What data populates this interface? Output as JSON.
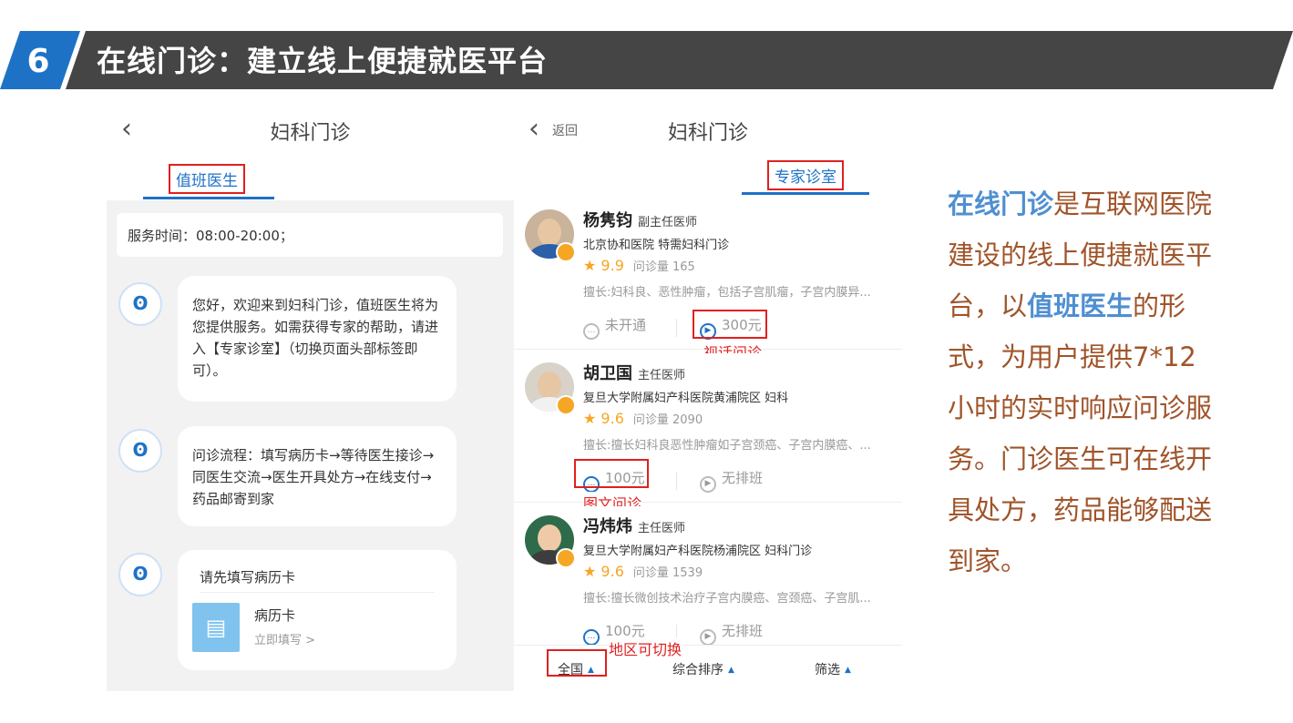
{
  "header": {
    "number": "6",
    "title": "在线门诊：建立线上便捷就医平台"
  },
  "left_screen": {
    "back_icon": "chevron-left-icon",
    "nav_title": "妇科门诊",
    "tab_label": "值班医生",
    "service_hours": "服务时间：08:00-20:00；",
    "messages": [
      "您好，欢迎来到妇科门诊，值班医生将为您提供服务。如需获得专家的帮助，请进入【专家诊室】（切换页面头部标签即可）。",
      "问诊流程：填写病历卡→等待医生接诊→同医生交流→医生开具处方→在线支付→药品邮寄到家"
    ],
    "form_prompt": "请先填写病历卡",
    "form_card": {
      "title": "病历卡",
      "link": "立即填写 >"
    }
  },
  "right_screen": {
    "back_label": "返回",
    "nav_title": "妇科门诊",
    "tab_label": "专家诊室",
    "doctors": [
      {
        "name": "杨隽钧",
        "title": "副主任医师",
        "hospital": "北京协和医院  特需妇科门诊",
        "rating": "★ 9.9",
        "volume": "问诊量 165",
        "specialty": "擅长:妇科良、恶性肿瘤，包括子宫肌瘤，子宫内膜异...",
        "service_a": "未开通",
        "service_b": "300元"
      },
      {
        "name": "胡卫国",
        "title": "主任医师",
        "hospital": "复旦大学附属妇产科医院黄浦院区  妇科",
        "rating": "★ 9.6",
        "volume": "问诊量 2090",
        "specialty": "擅长:擅长妇科良恶性肿瘤如子宫颈癌、子宫内膜癌、...",
        "service_a": "100元",
        "service_b": "无排班"
      },
      {
        "name": "冯炜炜",
        "title": "主任医师",
        "hospital": "复旦大学附属妇产科医院杨浦院区  妇科门诊",
        "rating": "★ 9.6",
        "volume": "问诊量 1539",
        "specialty": "擅长:擅长微创技术治疗子宫内膜癌、宫颈癌、子宫肌...",
        "service_a": "100元",
        "service_b": "无排班"
      }
    ],
    "annotations": {
      "video": "视话问诊",
      "text": "图文问诊",
      "region": "地区可切换"
    },
    "filters": [
      "全国",
      "综合排序",
      "筛选"
    ]
  },
  "description": {
    "segments": [
      {
        "text": "在线门诊",
        "highlight": true
      },
      {
        "text": "是互联网医院建设的线上便捷就医平台，以",
        "highlight": false
      },
      {
        "text": "值班医生",
        "highlight": true
      },
      {
        "text": "的形式，为用户提供7*12小时的实时响应问诊服务。门诊医生可在线开具处方，药品能够配送到家。",
        "highlight": false
      }
    ]
  },
  "colors": {
    "banner_blue": "#1e72c6",
    "banner_dark": "#454545",
    "highlight_blue": "#4f8fd1",
    "body_brown": "#a0542a",
    "annotation_red": "#e02020"
  }
}
